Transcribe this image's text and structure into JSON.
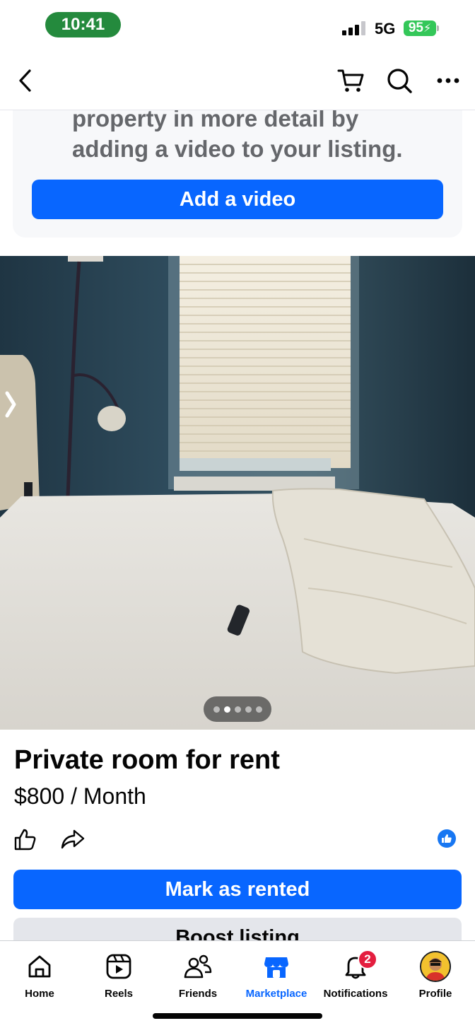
{
  "status_bar": {
    "time": "10:41",
    "network": "5G",
    "battery": "95",
    "time_pill_color": "#248a3d",
    "battery_color": "#34c759"
  },
  "nav_bar": {
    "icons": [
      "back-chevron-icon",
      "cart-icon",
      "search-icon",
      "more-icon"
    ]
  },
  "video_prompt": {
    "text": "property in more detail by adding a video to your listing.",
    "button_label": "Add a video"
  },
  "photo_carousel": {
    "total_photos": 5,
    "active_index": 1
  },
  "listing": {
    "title": "Private room for rent",
    "price": "$800 / Month"
  },
  "actions": {
    "mark_rented_label": "Mark as rented",
    "boost_label": "Boost listing"
  },
  "tab_bar": {
    "tabs": [
      {
        "label": "Home",
        "icon": "home-icon"
      },
      {
        "label": "Reels",
        "icon": "reels-icon"
      },
      {
        "label": "Friends",
        "icon": "friends-icon"
      },
      {
        "label": "Marketplace",
        "icon": "marketplace-icon"
      },
      {
        "label": "Notifications",
        "icon": "bell-icon"
      },
      {
        "label": "Profile",
        "icon": "avatar"
      }
    ],
    "active_tab": "Marketplace",
    "notifications_count": "2",
    "accent_color": "#0866ff"
  }
}
